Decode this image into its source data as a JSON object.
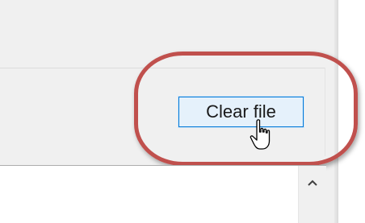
{
  "panel": {
    "clear_button_label": "Clear file"
  },
  "icons": {
    "scroll_up": "chevron-up-icon",
    "cursor": "mouse-pointer-icon"
  },
  "colors": {
    "highlight": "#c0504d",
    "button_border": "#0078d7",
    "button_bg": "#e5f1fb"
  }
}
